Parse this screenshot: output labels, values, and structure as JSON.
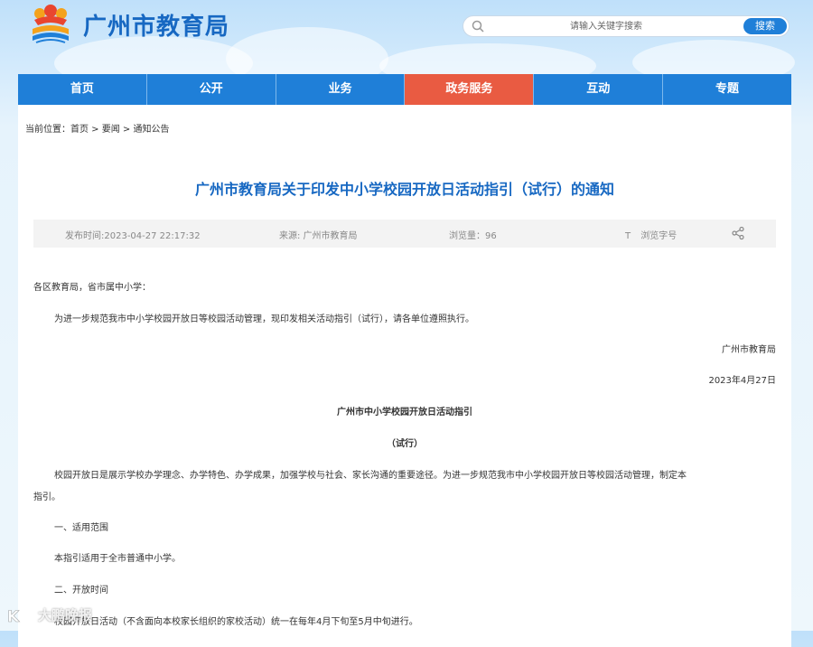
{
  "header": {
    "site_title": "广州市教育局",
    "logo_icon": "education-bureau-logo",
    "search_placeholder": "请输入关键字搜索",
    "search_button": "搜索"
  },
  "nav": {
    "items": [
      {
        "label": "首页"
      },
      {
        "label": "公开"
      },
      {
        "label": "业务"
      },
      {
        "label": "政务服务"
      },
      {
        "label": "互动"
      },
      {
        "label": "专题"
      }
    ],
    "active_index": 3,
    "colors": {
      "bar": "#1f7fd8",
      "active": "#e95b42"
    }
  },
  "breadcrumb": {
    "prefix": "当前位置：",
    "items": [
      "首页",
      "要闻",
      "通知公告"
    ],
    "separator": " > "
  },
  "article": {
    "title": "广州市教育局关于印发中小学校园开放日活动指引（试行）的通知",
    "title_color": "#1768c2",
    "meta": {
      "published": "发布时间:2023-04-27 22:17:32",
      "source": "来源: 广州市教育局",
      "views": "浏览量：96",
      "font_size_label": "浏览字号"
    },
    "addressee": "各区教育局，省市属中小学：",
    "intro": "为进一步规范我市中小学校园开放日等校园活动管理，现印发相关活动指引（试行），请各单位遵照执行。",
    "signature": "广州市教育局",
    "date": "2023年4月27日",
    "doc_title": "广州市中小学校园开放日活动指引",
    "doc_subtitle": "（试行）",
    "para1_line1": "校园开放日是展示学校办学理念、办学特色、办学成果，加强学校与社会、家长沟通的重要途径。为进一步规范我市中小学校园开放日等校园活动管理，制定本",
    "para1_line2": "指引。",
    "section1": "一、适用范围",
    "section1_text": "本指引适用于全市普通中小学。",
    "section2": "二、开放时间",
    "section2_text_partial": "校园开放日活动（不含面向本校家长组织的家校活动）统一在每年4月下旬至5月中旬进行。"
  },
  "watermark": {
    "text": "大鹏晚报"
  }
}
